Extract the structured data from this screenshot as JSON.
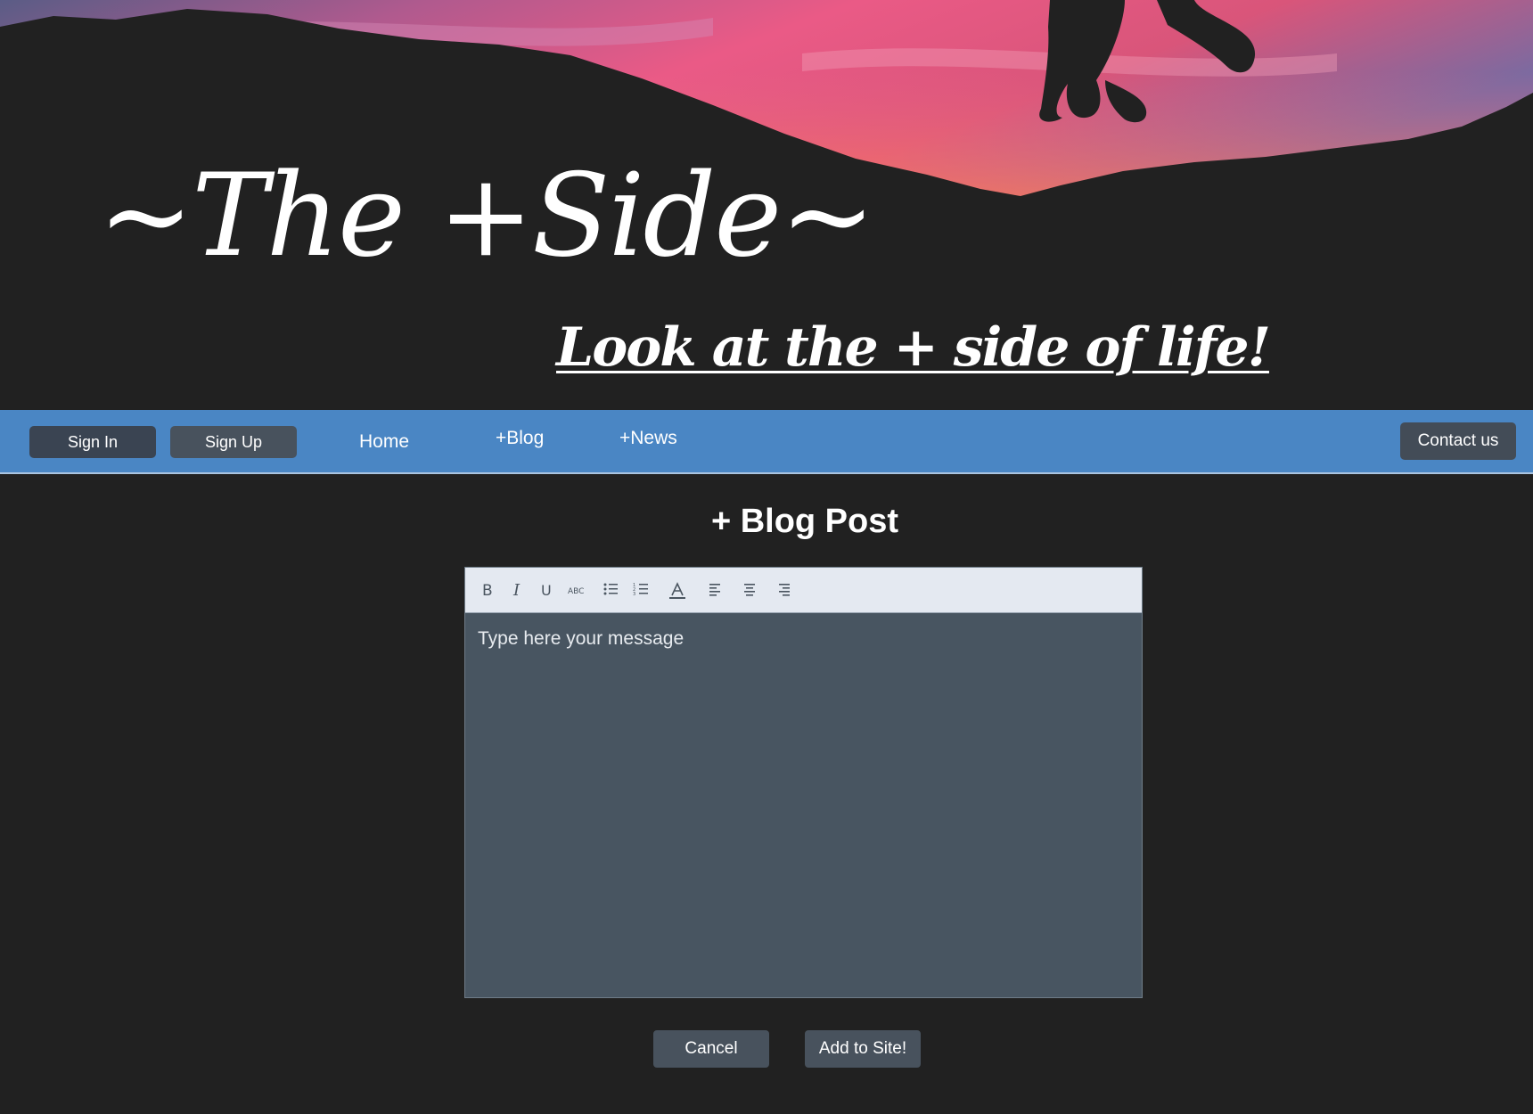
{
  "hero": {
    "title": "~The +Side~",
    "tagline": "Look at the + side of life!"
  },
  "nav": {
    "sign_in": "Sign In",
    "sign_up": "Sign Up",
    "home": "Home",
    "blog": "+Blog",
    "news": "+News",
    "contact": "Contact us"
  },
  "main": {
    "heading": "+ Blog Post",
    "editor": {
      "placeholder": "Type here your message",
      "toolbar": [
        "bold",
        "italic",
        "underline",
        "strikethrough",
        "bullet-list",
        "numbered-list",
        "font-color",
        "align-left",
        "align-center",
        "align-right"
      ]
    },
    "cancel_label": "Cancel",
    "add_label": "Add to Site!"
  },
  "colors": {
    "page_bg": "#212121",
    "navbar": "#4a86c4",
    "button": "#48525d",
    "editor_bg": "#485561",
    "toolbar_bg": "#e4e9f1"
  }
}
